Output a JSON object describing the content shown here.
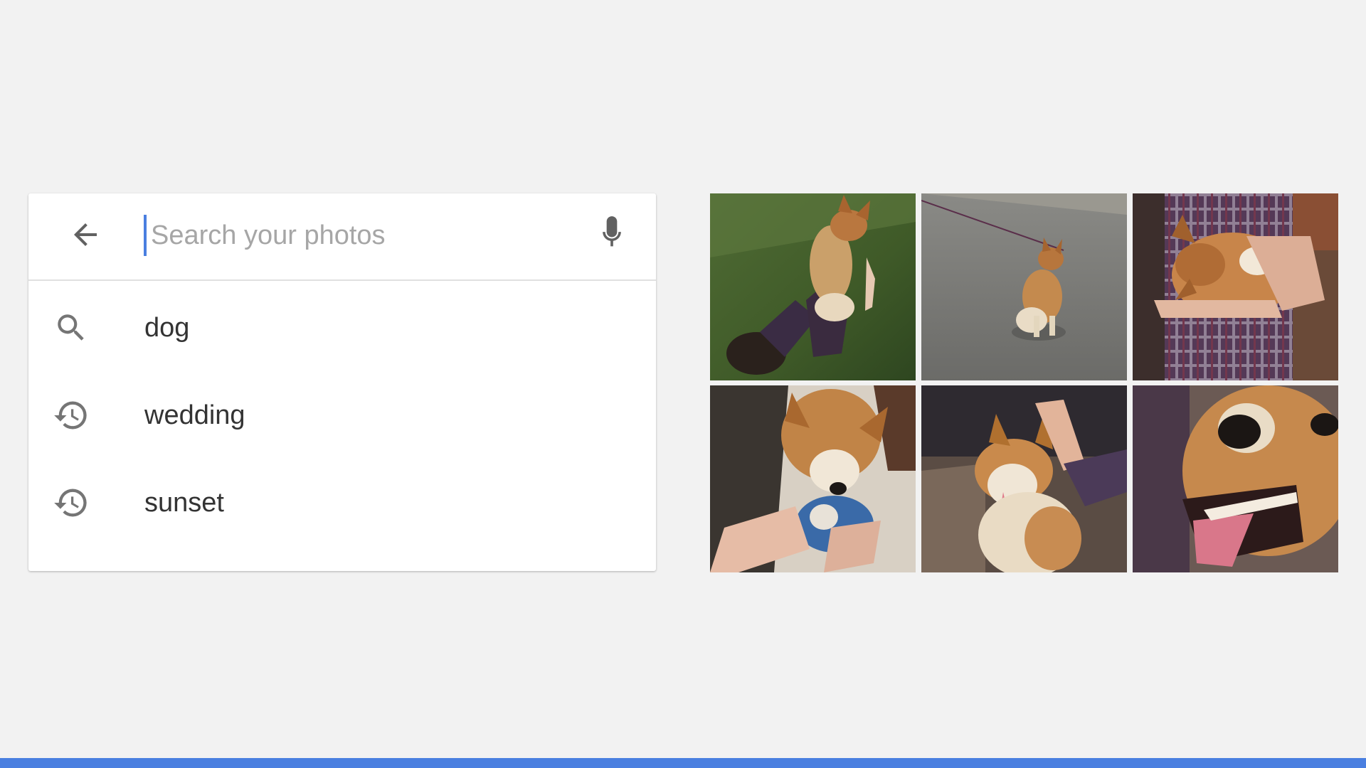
{
  "search": {
    "placeholder": "Search your photos",
    "value": ""
  },
  "icons": {
    "back": "arrow-left-icon",
    "mic": "microphone-icon",
    "search": "search-icon",
    "history": "history-icon"
  },
  "suggestions": [
    {
      "label": "dog",
      "icon": "search-icon"
    },
    {
      "label": "wedding",
      "icon": "history-icon"
    },
    {
      "label": "sunset",
      "icon": "history-icon"
    }
  ],
  "photos": [
    {
      "subject": "corgi jumping up to a woman lying on grass"
    },
    {
      "subject": "corgi on a leash walking on pavement"
    },
    {
      "subject": "woman holding a corgi in a kitchen"
    },
    {
      "subject": "corgi playing with a blue toy"
    },
    {
      "subject": "corgi being petted on a couch"
    },
    {
      "subject": "close-up of a smiling corgi"
    }
  ],
  "colors": {
    "background": "#f2f2f2",
    "accent": "#4a7fe0",
    "icon": "#757575",
    "text": "#333333",
    "placeholder": "#a6a6a6"
  }
}
